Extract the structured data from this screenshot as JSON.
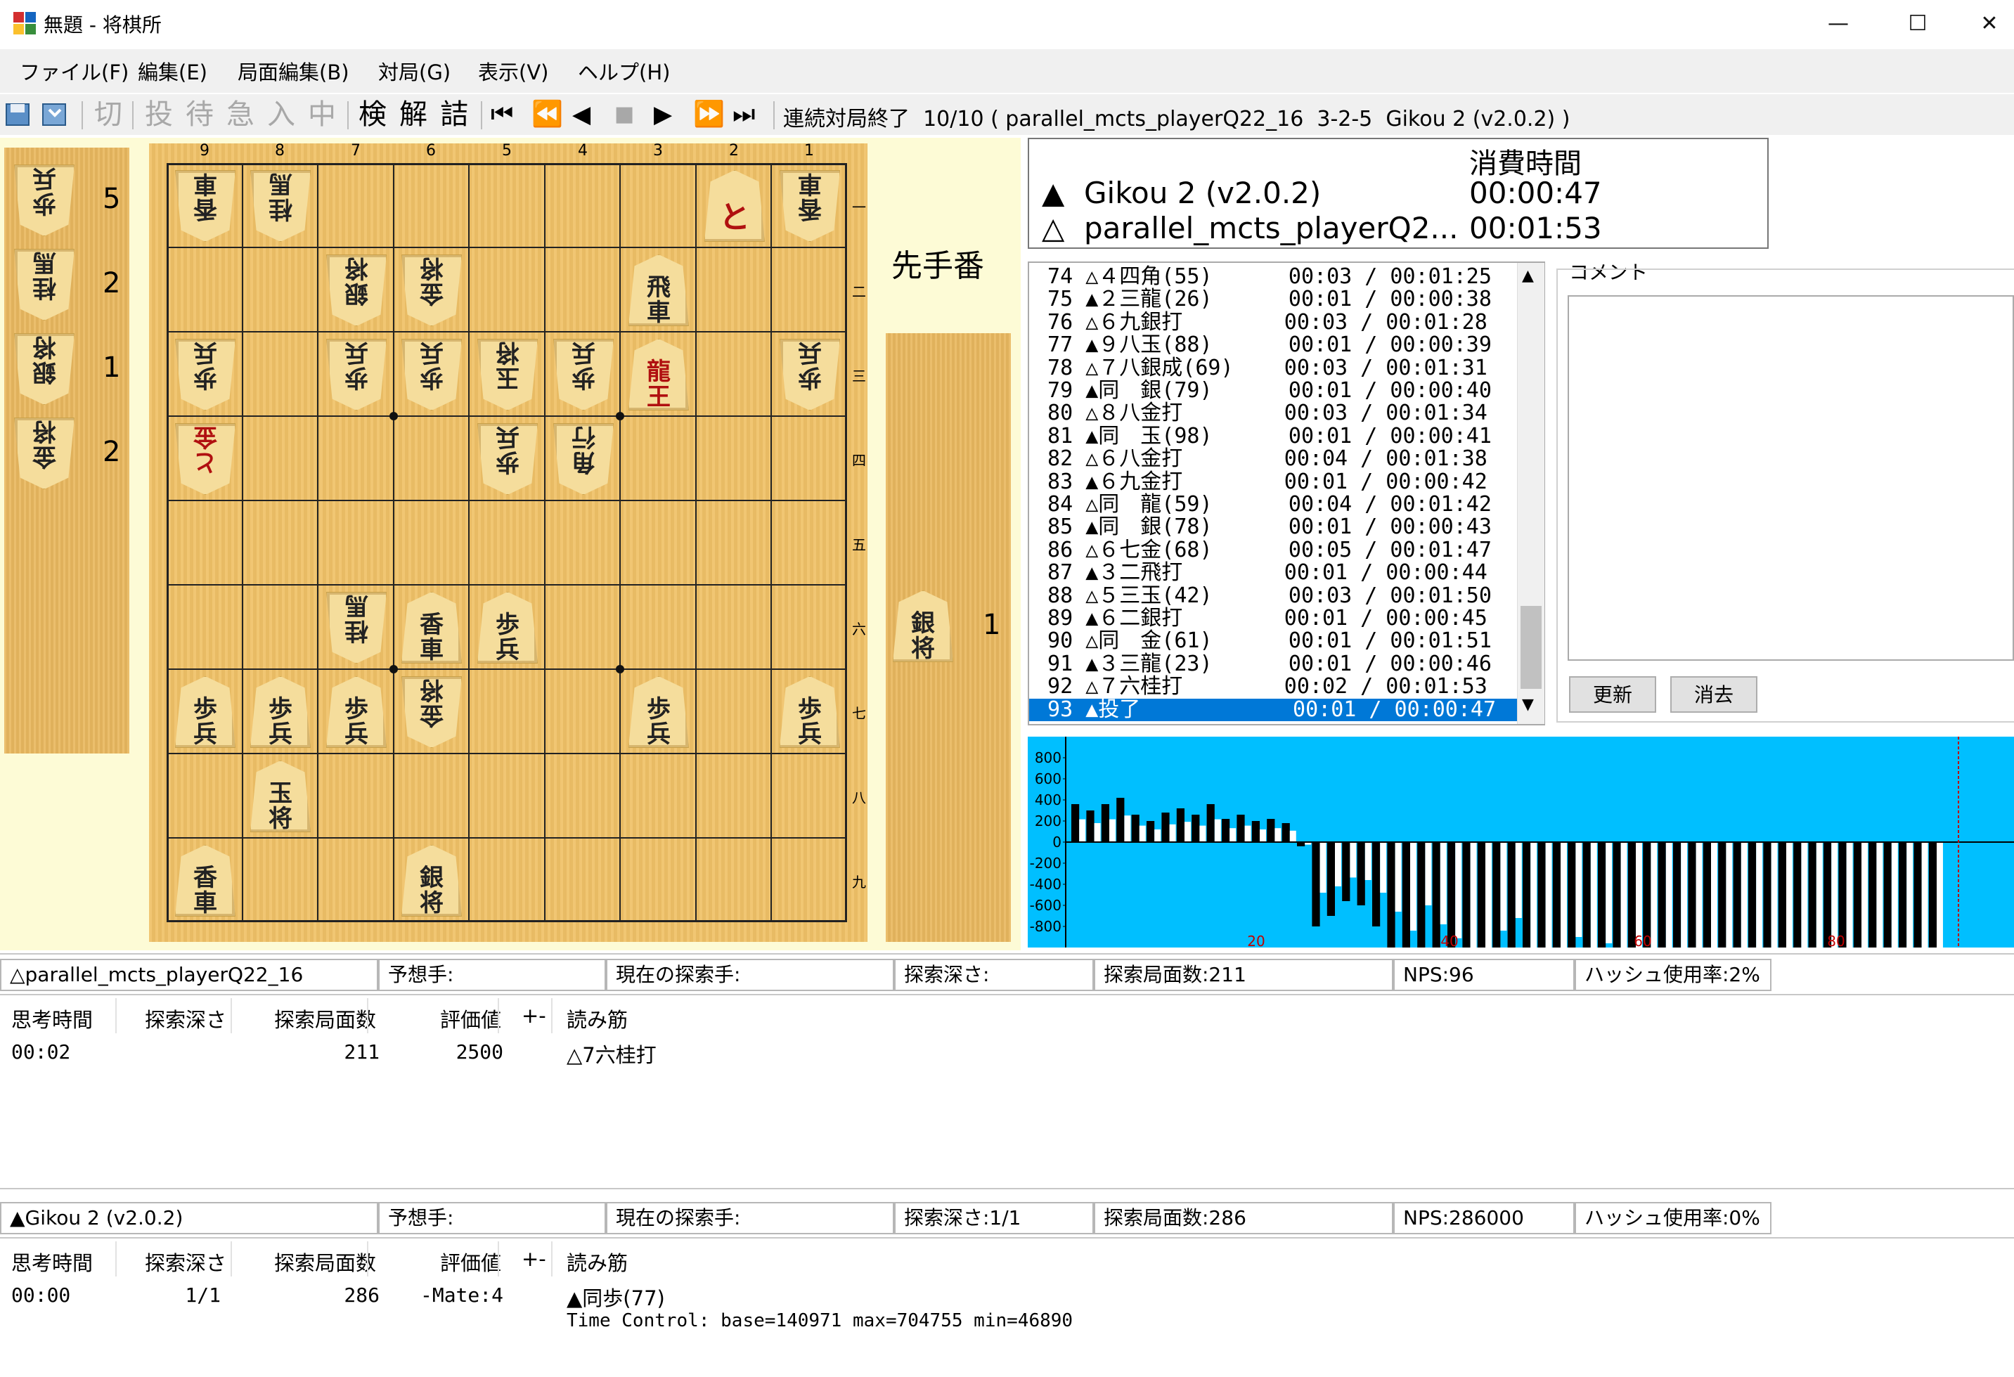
{
  "window": {
    "title": "無題 - 将棋所",
    "minimize": "—",
    "maximize": "☐",
    "close": "✕"
  },
  "menu": [
    "ファイル(F)",
    "編集(E)",
    "局面編集(B)",
    "対局(G)",
    "表示(V)",
    "ヘルプ(H)"
  ],
  "toolbar": {
    "kifu_buttons": [
      "切",
      "投",
      "待",
      "急",
      "入",
      "中"
    ],
    "tool_buttons": [
      "検",
      "解",
      "詰"
    ],
    "nav_buttons": [
      "⏮",
      "⏪",
      "◀",
      "■",
      "▶",
      "⏩",
      "⏭"
    ],
    "status": "連続対局終了  10/10 ( parallel_mcts_playerQ22_16  3-2-5  Gikou 2 (v2.0.2) )"
  },
  "board": {
    "col_numbers": [
      "9",
      "8",
      "7",
      "6",
      "5",
      "4",
      "3",
      "2",
      "1"
    ],
    "row_numbers": [
      "一",
      "二",
      "三",
      "四",
      "五",
      "六",
      "七",
      "八",
      "九"
    ],
    "turn_label": "先手番",
    "pieces": [
      {
        "col": 9,
        "row": 1,
        "a": "香",
        "b": "車",
        "gote": true
      },
      {
        "col": 8,
        "row": 1,
        "a": "桂",
        "b": "馬",
        "gote": true
      },
      {
        "col": 2,
        "row": 1,
        "a": "と",
        "b": "",
        "gote": false,
        "promoted": true
      },
      {
        "col": 1,
        "row": 1,
        "a": "香",
        "b": "車",
        "gote": true
      },
      {
        "col": 7,
        "row": 2,
        "a": "銀",
        "b": "将",
        "gote": true
      },
      {
        "col": 6,
        "row": 2,
        "a": "金",
        "b": "将",
        "gote": true
      },
      {
        "col": 3,
        "row": 2,
        "a": "飛",
        "b": "車",
        "gote": false
      },
      {
        "col": 9,
        "row": 3,
        "a": "歩",
        "b": "兵",
        "gote": true
      },
      {
        "col": 7,
        "row": 3,
        "a": "歩",
        "b": "兵",
        "gote": true
      },
      {
        "col": 6,
        "row": 3,
        "a": "歩",
        "b": "兵",
        "gote": true
      },
      {
        "col": 5,
        "row": 3,
        "a": "玉",
        "b": "将",
        "gote": true
      },
      {
        "col": 4,
        "row": 3,
        "a": "歩",
        "b": "兵",
        "gote": true
      },
      {
        "col": 3,
        "row": 3,
        "a": "龍",
        "b": "王",
        "gote": false,
        "promoted": true
      },
      {
        "col": 1,
        "row": 3,
        "a": "歩",
        "b": "兵",
        "gote": true
      },
      {
        "col": 9,
        "row": 4,
        "a": "と",
        "b": "金",
        "gote": true,
        "promoted": true
      },
      {
        "col": 5,
        "row": 4,
        "a": "歩",
        "b": "兵",
        "gote": true
      },
      {
        "col": 4,
        "row": 4,
        "a": "角",
        "b": "行",
        "gote": true
      },
      {
        "col": 7,
        "row": 6,
        "a": "桂",
        "b": "馬",
        "gote": true
      },
      {
        "col": 6,
        "row": 6,
        "a": "香",
        "b": "車",
        "gote": false
      },
      {
        "col": 5,
        "row": 6,
        "a": "歩",
        "b": "兵",
        "gote": false
      },
      {
        "col": 9,
        "row": 7,
        "a": "歩",
        "b": "兵",
        "gote": false
      },
      {
        "col": 8,
        "row": 7,
        "a": "歩",
        "b": "兵",
        "gote": false
      },
      {
        "col": 7,
        "row": 7,
        "a": "歩",
        "b": "兵",
        "gote": false
      },
      {
        "col": 6,
        "row": 7,
        "a": "金",
        "b": "将",
        "gote": true
      },
      {
        "col": 3,
        "row": 7,
        "a": "歩",
        "b": "兵",
        "gote": false
      },
      {
        "col": 1,
        "row": 7,
        "a": "歩",
        "b": "兵",
        "gote": false
      },
      {
        "col": 8,
        "row": 8,
        "a": "玉",
        "b": "将",
        "gote": false
      },
      {
        "col": 9,
        "row": 9,
        "a": "香",
        "b": "車",
        "gote": false
      },
      {
        "col": 6,
        "row": 9,
        "a": "銀",
        "b": "将",
        "gote": false
      }
    ]
  },
  "gote_hand": [
    {
      "a": "歩",
      "b": "兵",
      "count": "5"
    },
    {
      "a": "桂",
      "b": "馬",
      "count": "2"
    },
    {
      "a": "銀",
      "b": "将",
      "count": "1"
    },
    {
      "a": "金",
      "b": "将",
      "count": "2"
    }
  ],
  "sente_hand": [
    {
      "a": "銀",
      "b": "将",
      "count": "1"
    }
  ],
  "players": {
    "time_header": "消費時間",
    "sente_mark": "▲",
    "sente_name": "Gikou 2 (v2.0.2)",
    "sente_time": "00:00:47",
    "gote_mark": "△",
    "gote_name": "parallel_mcts_playerQ2...",
    "gote_time": "00:01:53"
  },
  "moves": [
    " 74 △４四角(55)      00:03 / 00:01:25",
    " 75 ▲２三龍(26)      00:01 / 00:00:38",
    " 76 △６九銀打        00:03 / 00:01:28",
    " 77 ▲９八玉(88)      00:01 / 00:00:39",
    " 78 △７八銀成(69)    00:03 / 00:01:31",
    " 79 ▲同　銀(79)      00:01 / 00:00:40",
    " 80 △８八金打        00:03 / 00:01:34",
    " 81 ▲同　玉(98)      00:01 / 00:00:41",
    " 82 △６八金打        00:04 / 00:01:38",
    " 83 ▲６九金打        00:01 / 00:00:42",
    " 84 △同　龍(59)      00:04 / 00:01:42",
    " 85 ▲同　銀(78)      00:01 / 00:00:43",
    " 86 △６七金(68)      00:05 / 00:01:47",
    " 87 ▲３二飛打        00:01 / 00:00:44",
    " 88 △５三玉(42)      00:03 / 00:01:50",
    " 89 ▲６二銀打        00:01 / 00:00:45",
    " 90 △同　金(61)      00:01 / 00:01:51",
    " 91 ▲３三龍(23)      00:01 / 00:00:46",
    " 92 △７六桂打        00:02 / 00:01:53",
    " 93 ▲投了            00:01 / 00:00:47"
  ],
  "comment": {
    "label": "コメント",
    "update_button": "更新",
    "clear_button": "消去"
  },
  "graph": {
    "y_ticks": [
      "800",
      "600",
      "400",
      "200",
      "0",
      "-200",
      "-400",
      "-600",
      "-800"
    ],
    "x_ticks": [
      "20",
      "40",
      "60",
      "80"
    ],
    "ylim": [
      -1000,
      1000
    ],
    "bars": [
      180,
      150,
      180,
      210,
      130,
      100,
      140,
      160,
      130,
      180,
      110,
      130,
      100,
      110,
      90,
      -20,
      -400,
      -350,
      -280,
      -300,
      -400,
      -550,
      -700,
      -500,
      -650,
      -760,
      -850,
      -900,
      -700,
      -600,
      -900,
      -1000,
      -1000,
      -750,
      -1000,
      -800,
      -1000,
      -1000,
      -1000,
      -1000,
      -1000,
      -1000,
      -1000,
      -1000,
      -1000,
      -1000,
      -1000,
      -1000,
      -1000,
      -1000,
      -1000,
      -1000,
      -1000,
      -1000,
      -1000,
      -1000,
      -1000,
      -1000
    ],
    "colors": {
      "bg": "#00bfff",
      "sente": "#ffffff",
      "gote": "#000000"
    }
  },
  "engine1": {
    "status": [
      "△parallel_mcts_playerQ22_16",
      "予想手:",
      "現在の探索手:",
      "探索深さ:",
      "探索局面数:211",
      "NPS:96",
      "ハッシュ使用率:2%"
    ],
    "headers": [
      "思考時間",
      "探索深さ",
      "探索局面数",
      "評価値",
      "+-",
      "読み筋"
    ],
    "row": [
      "00:02",
      "",
      "211",
      "2500",
      "",
      "△7六桂打"
    ]
  },
  "engine2": {
    "status": [
      "▲Gikou 2 (v2.0.2)",
      "予想手:",
      "現在の探索手:",
      "探索深さ:1/1",
      "探索局面数:286",
      "NPS:286000",
      "ハッシュ使用率:0%"
    ],
    "headers": [
      "思考時間",
      "探索深さ",
      "探索局面数",
      "評価値",
      "+-",
      "読み筋"
    ],
    "row": [
      "00:00",
      "1/1",
      "286",
      "-Mate:4",
      "",
      "▲同歩(77)"
    ],
    "extra": "Time Control: base=140971 max=704755 min=46890"
  }
}
